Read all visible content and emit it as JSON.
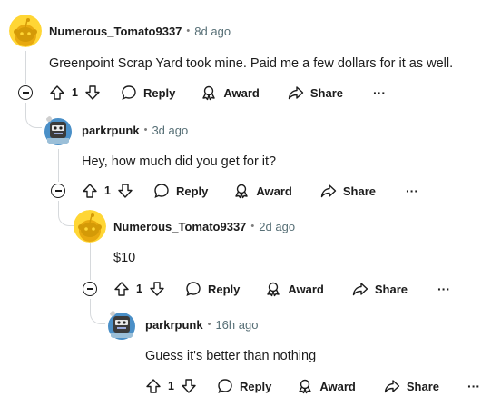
{
  "colors": {
    "snoo_yellow": "#f2c71c",
    "line": "#d6d9dc",
    "meta": "#576f76"
  },
  "actions": {
    "reply": "Reply",
    "award": "Award",
    "share": "Share",
    "more": "···"
  },
  "comments": [
    {
      "author": "Numerous_Tomato9337",
      "separator": "•",
      "time": "8d ago",
      "body": "Greenpoint Scrap Yard took mine. Paid me a few dollars for it as well.",
      "votes": "1",
      "avatar_icon": "snoo-yellow-avatar-icon"
    },
    {
      "author": "parkrpunk",
      "separator": "•",
      "time": "3d ago",
      "body": "Hey, how much did you get for it?",
      "votes": "1",
      "avatar_icon": "robot-avatar-icon"
    },
    {
      "author": "Numerous_Tomato9337",
      "separator": "•",
      "time": "2d ago",
      "body": "$10",
      "votes": "1",
      "avatar_icon": "snoo-yellow-avatar-icon"
    },
    {
      "author": "parkrpunk",
      "separator": "•",
      "time": "16h ago",
      "body": "Guess it's better than nothing",
      "votes": "1",
      "avatar_icon": "robot-avatar-icon"
    }
  ]
}
